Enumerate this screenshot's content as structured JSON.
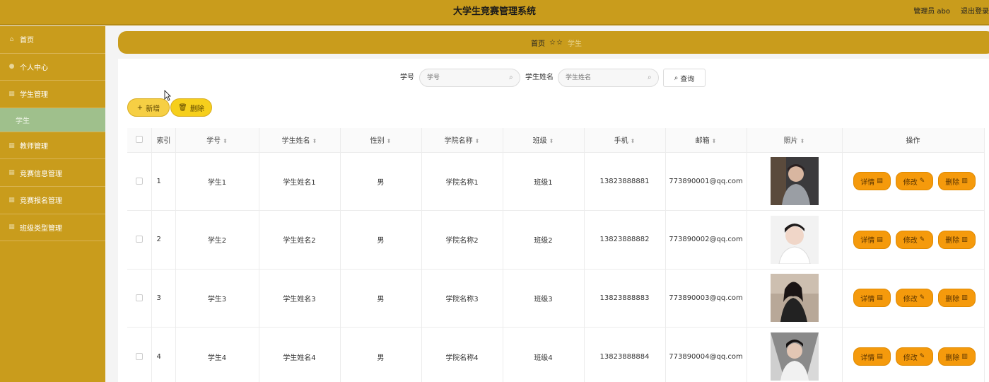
{
  "header": {
    "title": "大学生竞赛管理系统",
    "user": "管理员 abo",
    "logout": "退出登录"
  },
  "sidebar": {
    "items": [
      {
        "label": "首页",
        "icon": "home-icon"
      },
      {
        "label": "个人中心",
        "icon": "user-icon"
      },
      {
        "label": "学生管理",
        "icon": "grid-icon"
      },
      {
        "label": "学生",
        "icon": "",
        "sub": true
      },
      {
        "label": "教师管理",
        "icon": "grid-icon"
      },
      {
        "label": "竞赛信息管理",
        "icon": "grid-icon"
      },
      {
        "label": "竞赛报名管理",
        "icon": "grid-icon"
      },
      {
        "label": "班级类型管理",
        "icon": "grid-icon"
      }
    ]
  },
  "breadcrumb": {
    "home": "首页",
    "current": "学生"
  },
  "search": {
    "label1": "学号",
    "placeholder1": "学号",
    "label2": "学生姓名",
    "placeholder2": "学生姓名",
    "button": "查询"
  },
  "actions": {
    "add": "新增",
    "delete": "删除"
  },
  "table": {
    "headers": [
      "索引",
      "学号",
      "学生姓名",
      "性别",
      "学院名称",
      "班级",
      "手机",
      "邮箱",
      "照片",
      "操作"
    ],
    "op_labels": {
      "detail": "详情",
      "edit": "修改",
      "delete": "删除"
    },
    "rows": [
      {
        "index": "1",
        "id": "学生1",
        "name": "学生姓名1",
        "gender": "男",
        "college": "学院名称1",
        "class": "班级1",
        "phone": "13823888881",
        "email": "773890001@qq.com"
      },
      {
        "index": "2",
        "id": "学生2",
        "name": "学生姓名2",
        "gender": "男",
        "college": "学院名称2",
        "class": "班级2",
        "phone": "13823888882",
        "email": "773890002@qq.com"
      },
      {
        "index": "3",
        "id": "学生3",
        "name": "学生姓名3",
        "gender": "男",
        "college": "学院名称3",
        "class": "班级3",
        "phone": "13823888883",
        "email": "773890003@qq.com"
      },
      {
        "index": "4",
        "id": "学生4",
        "name": "学生姓名4",
        "gender": "男",
        "college": "学院名称4",
        "class": "班级4",
        "phone": "13823888884",
        "email": "773890004@qq.com"
      }
    ]
  },
  "colors": {
    "brand": "#c99c1c",
    "button": "#f59a0c",
    "active": "#9fc08c"
  }
}
